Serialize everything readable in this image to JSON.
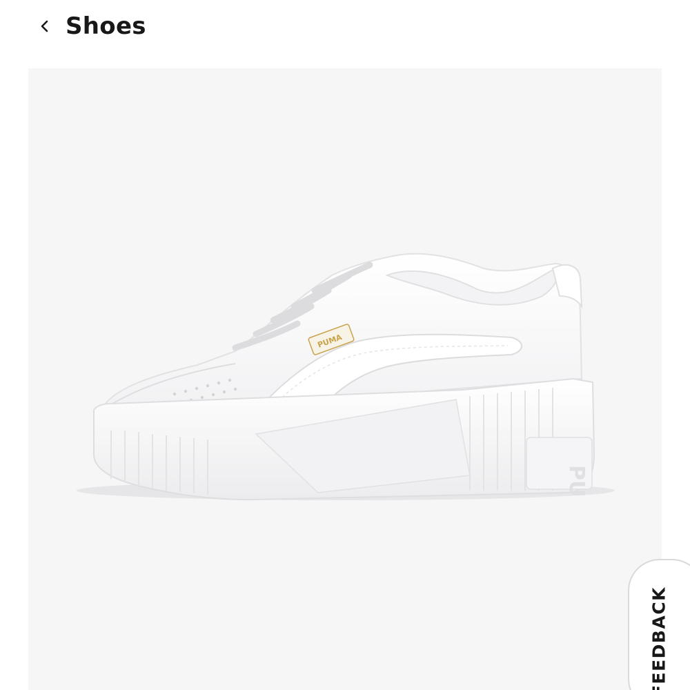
{
  "header": {
    "back_label": "Shoes",
    "back_icon": "chevron-left-icon"
  },
  "product": {
    "image_alt": "White platform sneaker, side view",
    "colors": {
      "panel_background": "#f6f6f7",
      "shoe_white": "#ffffff",
      "shoe_shadow": "#e3e3e5",
      "logo_gold": "#c9a24a"
    },
    "sole_logo_text": "PU",
    "tongue_logo_text": "PUMA"
  },
  "feedback": {
    "label": "FEEDBACK"
  }
}
